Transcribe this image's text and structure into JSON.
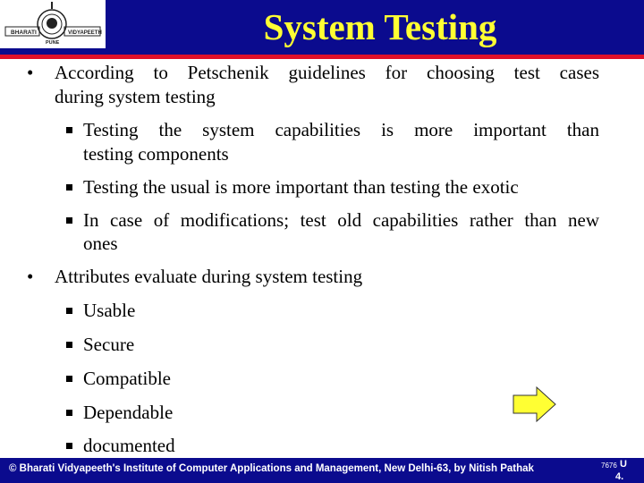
{
  "header": {
    "title": "System Testing",
    "logo": {
      "left_text": "BHARATI",
      "right_text": "VIDYAPEETH",
      "bottom_text": "PUNE"
    },
    "colors": {
      "bar": "#0b0b8e",
      "title": "#ffff33",
      "stripe": "#e0102a"
    }
  },
  "content": {
    "bullets": [
      {
        "text": "According to Petschenik guidelines for choosing test cases during system testing",
        "line1": "According to Petschenik guidelines for choosing test cases",
        "line2": "during system testing",
        "sub": [
          {
            "line1": "Testing the system capabilities is more important than",
            "line2": "testing components"
          },
          {
            "line1": "Testing the usual is more important than testing the exotic"
          },
          {
            "line1": "In case of modifications; test old capabilities rather than new",
            "line2": "ones"
          }
        ]
      },
      {
        "line1": "Attributes evaluate during system testing",
        "sub": [
          {
            "line1": "Usable"
          },
          {
            "line1": "Secure"
          },
          {
            "line1": "Compatible"
          },
          {
            "line1": "Dependable"
          },
          {
            "line1": "documented"
          }
        ]
      }
    ],
    "bullet_glyph": "•"
  },
  "navigation": {
    "next_arrow_icon": "right-arrow-icon",
    "arrow_color": "#ffff33"
  },
  "footer": {
    "copyright": "© Bharati Vidyapeeth's Institute of Computer Applications and Management, New Delhi-63, by  Nitish Pathak",
    "page_small": "7676",
    "page_u": "U",
    "page_num": "4."
  }
}
